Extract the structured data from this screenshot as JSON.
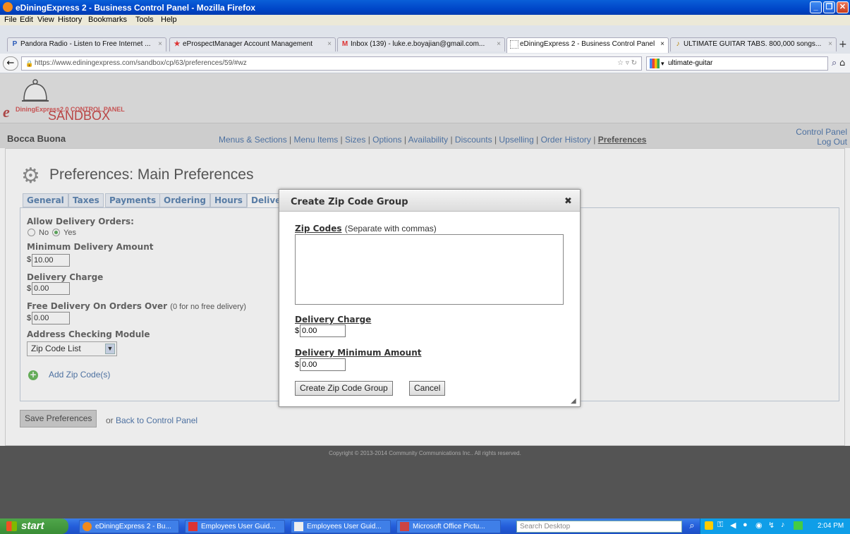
{
  "window": {
    "title": "eDiningExpress 2 - Business Control Panel - Mozilla Firefox"
  },
  "menubar": [
    "File",
    "Edit",
    "View",
    "History",
    "Bookmarks",
    "Tools",
    "Help"
  ],
  "browser_tabs": [
    {
      "label": "Pandora Radio - Listen to Free Internet ...",
      "icon": "P"
    },
    {
      "label": "eProspectManager Account Management",
      "icon": "★"
    },
    {
      "label": "Inbox (139) - luke.e.boyajian@gmail.com...",
      "icon": "M"
    },
    {
      "label": "eDiningExpress 2 - Business Control Panel",
      "icon": ""
    },
    {
      "label": "ULTIMATE GUITAR TABS. 800,000 songs...",
      "icon": "♪"
    }
  ],
  "address": {
    "url": "https://www.ediningexpress.com/sandbox/cp/63/preferences/59/#wz",
    "search": "ultimate-guitar"
  },
  "site": {
    "logo_text": "DiningExpress2.0 CONTROL PANEL",
    "env_label": "SANDBOX",
    "restaurant": "Bocca Buona",
    "nav": [
      "Menus & Sections",
      "Menu Items",
      "Sizes",
      "Options",
      "Availability",
      "Discounts",
      "Upselling",
      "Order History",
      "Preferences"
    ],
    "control_panel": "Control Panel",
    "logout": "Log Out"
  },
  "page": {
    "title": "Preferences: Main Preferences",
    "tabs": [
      "General",
      "Taxes",
      "Payments",
      "Ordering",
      "Hours",
      "Delive"
    ],
    "allow_delivery_label": "Allow Delivery Orders:",
    "radio_no": "No",
    "radio_yes": "Yes",
    "min_delivery_label": "Minimum Delivery Amount",
    "min_delivery_value": "10.00",
    "delivery_charge_label": "Delivery Charge",
    "delivery_charge_value": "0.00",
    "free_delivery_label": "Free Delivery On Orders Over",
    "free_delivery_note": "(0 for no free delivery)",
    "free_delivery_value": "0.00",
    "address_module_label": "Address Checking Module",
    "address_module_value": "Zip Code List",
    "add_zip_link": "Add Zip Code(s)",
    "currency": "$",
    "save_button": "Save Preferences",
    "or_text": "or",
    "back_link": "Back to Control Panel"
  },
  "footer": {
    "copyright": "Copyright © 2013-2014 Community Communications Inc.. All rights reserved."
  },
  "modal": {
    "title": "Create Zip Code Group",
    "close": "✖",
    "zip_label": "Zip Codes",
    "zip_hint": "(Separate with commas)",
    "zip_value": "",
    "charge_label": "Delivery Charge",
    "charge_value": "0.00",
    "min_label": "Delivery Minimum Amount",
    "min_value": "0.00",
    "create_button": "Create Zip Code Group",
    "cancel_button": "Cancel"
  },
  "taskbar": {
    "start": "start",
    "items": [
      "eDiningExpress 2 - Bu...",
      "Employees User Guid...",
      "Employees User Guid...",
      "Microsoft Office Pictu..."
    ],
    "search_placeholder": "Search Desktop",
    "clock": "2:04 PM"
  }
}
